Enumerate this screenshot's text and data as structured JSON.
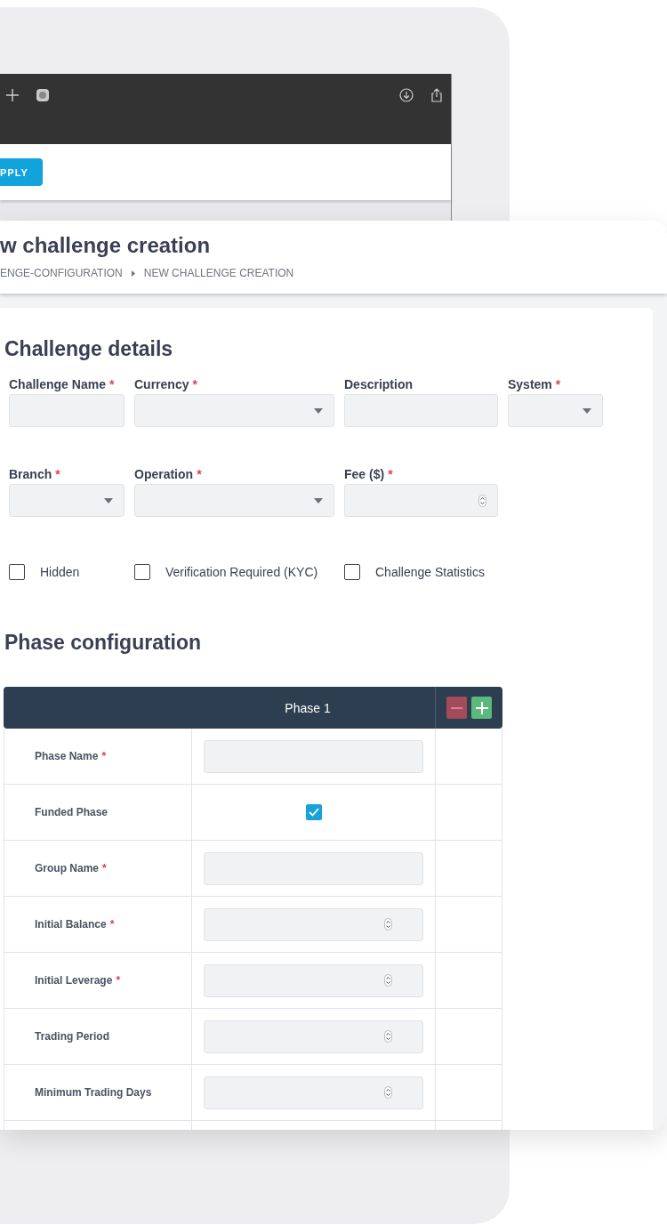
{
  "background_window": {
    "apply_button": "PPLY"
  },
  "page": {
    "title": "w challenge creation",
    "breadcrumb": [
      {
        "label": "ENGE-CONFIGURATION"
      },
      {
        "label": "NEW CHALLENGE CREATION"
      }
    ]
  },
  "challenge_details": {
    "heading": "Challenge details",
    "fields": [
      {
        "label": "Challenge Name",
        "required_mark": "*",
        "kind": "text"
      },
      {
        "label": "Currency",
        "required_mark": "*",
        "kind": "select"
      },
      {
        "label": "Description",
        "kind": "text"
      },
      {
        "label": "System",
        "required_mark": "*",
        "kind": "select"
      },
      {
        "label": "Branch",
        "required_mark": "*",
        "kind": "select"
      },
      {
        "label": "Operation",
        "required_mark": "*",
        "kind": "select"
      },
      {
        "label": "Fee ($)",
        "required_mark": "*",
        "kind": "number"
      }
    ],
    "checkboxes": [
      {
        "label": "Hidden",
        "checked": false
      },
      {
        "label": "Verification Required (KYC)",
        "checked": false
      },
      {
        "label": "Challenge Statistics",
        "checked": false
      }
    ]
  },
  "phase_configuration": {
    "heading": "Phase configuration",
    "phase_title": "Phase 1",
    "rows": [
      {
        "label": "Phase Name",
        "required_mark": "*",
        "kind": "text"
      },
      {
        "label": "Funded Phase",
        "kind": "checkbox",
        "checked": true
      },
      {
        "label": "Group Name",
        "required_mark": "*",
        "kind": "text"
      },
      {
        "label": "Initial Balance",
        "required_mark": "*",
        "kind": "number"
      },
      {
        "label": "Initial Leverage",
        "required_mark": "*",
        "kind": "number"
      },
      {
        "label": "Trading Period",
        "kind": "number"
      },
      {
        "label": "Minimum Trading Days",
        "kind": "number"
      }
    ]
  }
}
